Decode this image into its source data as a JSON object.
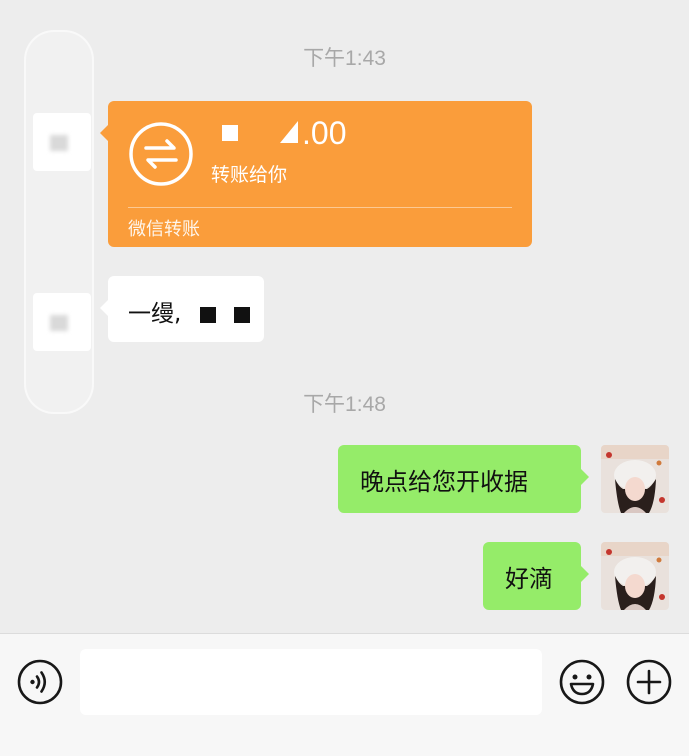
{
  "chat": {
    "timestamp_1": "下午1:43",
    "timestamp_2": "下午1:48",
    "transfer": {
      "amount_visible": ".00",
      "description": "转账给你",
      "footer": "微信转账"
    },
    "incoming_message": "一缦,",
    "outgoing_messages": [
      {
        "text": "晚点给您开收据"
      },
      {
        "text": "好滴"
      }
    ]
  },
  "input_bar": {
    "voice_icon": "voice-icon",
    "emoji_icon": "emoji-icon",
    "add_icon": "plus-icon",
    "input_value": ""
  },
  "colors": {
    "background": "#ededed",
    "transfer_orange": "#fa9d3b",
    "outgoing_green": "#95ec69",
    "incoming_white": "#ffffff"
  }
}
